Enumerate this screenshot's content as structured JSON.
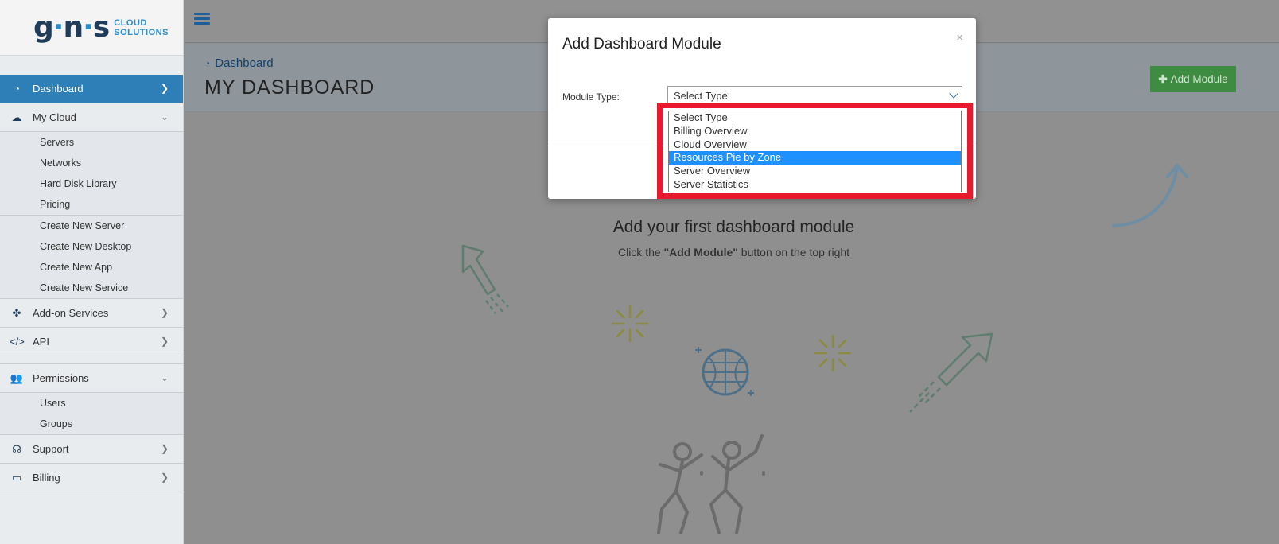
{
  "logo": {
    "mark_g": "g",
    "mark_n": "n",
    "mark_s": "s",
    "line1": "CLOUD",
    "line2": "SOLUTIONS"
  },
  "sidebar": {
    "dashboard": "Dashboard",
    "my_cloud": "My Cloud",
    "my_cloud_items": [
      "Servers",
      "Networks",
      "Hard Disk Library",
      "Pricing"
    ],
    "create_items": [
      "Create New Server",
      "Create New Desktop",
      "Create New App",
      "Create New Service"
    ],
    "addon": "Add-on Services",
    "api": "API",
    "permissions": "Permissions",
    "permission_items": [
      "Users",
      "Groups"
    ],
    "support": "Support",
    "billing": "Billing"
  },
  "header": {
    "breadcrumb": "Dashboard",
    "title": "MY DASHBOARD",
    "add_module": "Add Module"
  },
  "empty_state": {
    "title": "Add your first dashboard module",
    "hint_prefix": "Click the ",
    "hint_bold": "\"Add Module\"",
    "hint_suffix": " button on the top right"
  },
  "modal": {
    "title": "Add Dashboard Module",
    "close": "×",
    "field_label": "Module Type:",
    "selected_value": "Select Type",
    "options": [
      "Select Type",
      "Billing Overview",
      "Cloud Overview",
      "Resources Pie by Zone",
      "Server Overview",
      "Server Statistics"
    ],
    "highlighted_option": "Resources Pie by Zone"
  },
  "colors": {
    "accent": "#2e7fb8",
    "add_button": "#3e8c41",
    "highlight_box": "#e8192c",
    "option_selected": "#1e90ff"
  }
}
